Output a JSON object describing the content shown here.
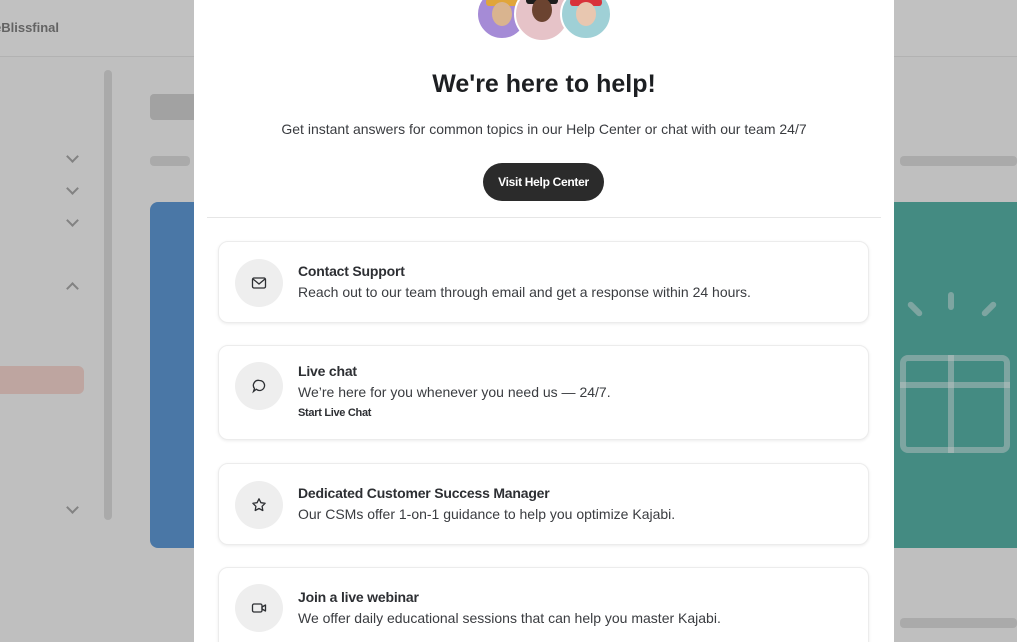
{
  "background": {
    "logo_text": "eBlissfinal"
  },
  "modal": {
    "title": "We're here to help!",
    "subtitle": "Get instant answers for common topics in our Help Center or chat with our team 24/7",
    "help_center_button": "Visit Help Center",
    "avatars": [
      "support-agent-1",
      "support-agent-2",
      "support-agent-3"
    ],
    "options": [
      {
        "icon": "mail-icon",
        "title": "Contact Support",
        "description": "Reach out to our team through email and get a response within 24 hours."
      },
      {
        "icon": "chat-icon",
        "title": "Live chat",
        "description": "We’re here for you whenever you need us — 24/7.",
        "link": "Start Live Chat"
      },
      {
        "icon": "star-icon",
        "title": "Dedicated Customer Success Manager",
        "description": "Our CSMs offer 1-on-1 guidance to help you optimize Kajabi."
      },
      {
        "icon": "video-icon",
        "title": "Join a live webinar",
        "description": "We offer daily educational sessions that can help you master Kajabi."
      }
    ]
  },
  "colors": {
    "button_bg": "#2b2b2b",
    "overlay": "rgba(120,120,120,0.42)",
    "icon_bg": "#eeeeee"
  }
}
